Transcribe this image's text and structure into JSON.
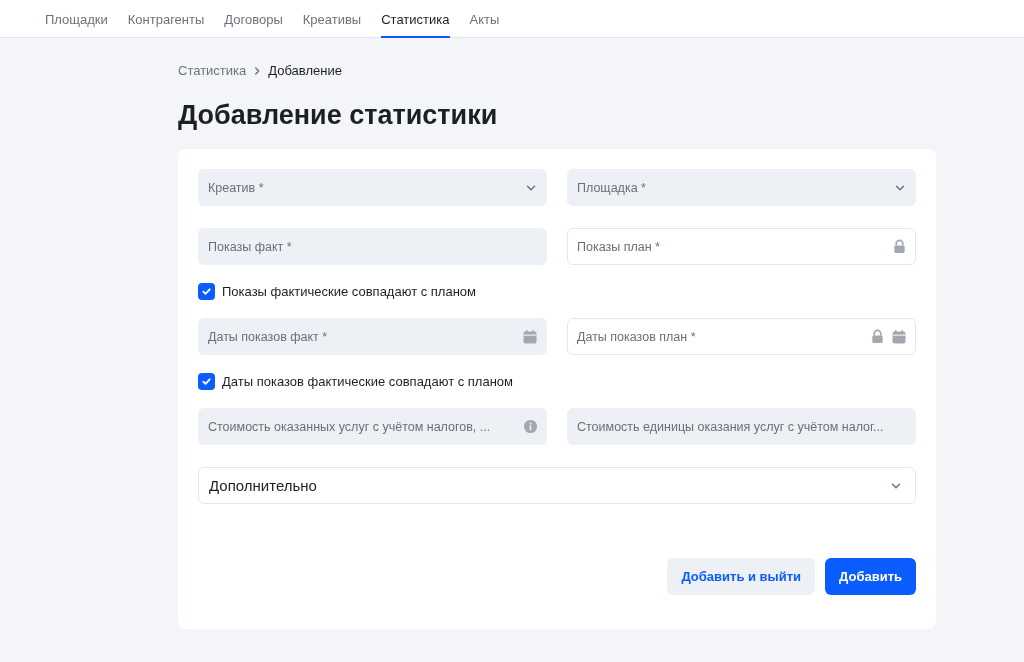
{
  "nav": {
    "tabs": [
      {
        "label": "Площадки",
        "selected": false
      },
      {
        "label": "Контрагенты",
        "selected": false
      },
      {
        "label": "Договоры",
        "selected": false
      },
      {
        "label": "Креативы",
        "selected": false
      },
      {
        "label": "Статистика",
        "selected": true
      },
      {
        "label": "Акты",
        "selected": false
      }
    ]
  },
  "breadcrumbs": [
    {
      "label": "Статистика"
    },
    {
      "label": "Добавление"
    }
  ],
  "title": "Добавление статистики",
  "form": {
    "rows": [
      {
        "kind": "fields",
        "fields": [
          {
            "kind": "select",
            "placeholder": "Креатив *",
            "locked": false,
            "info": false
          },
          {
            "kind": "select",
            "placeholder": "Площадка *",
            "locked": false,
            "info": false
          }
        ]
      },
      {
        "kind": "fields",
        "fields": [
          {
            "kind": "text",
            "placeholder": "Показы факт *",
            "locked": false,
            "info": false
          },
          {
            "kind": "text",
            "placeholder": "Показы план *",
            "locked": true,
            "info": false
          }
        ]
      },
      {
        "kind": "checkbox",
        "label": "Показы фактические совпадают с планом",
        "checked": true
      },
      {
        "kind": "fields",
        "fields": [
          {
            "kind": "date",
            "placeholder": "Даты показов факт *",
            "locked": false,
            "info": false
          },
          {
            "kind": "date",
            "placeholder": "Даты показов план *",
            "locked": true,
            "info": false
          }
        ]
      },
      {
        "kind": "checkbox",
        "label": "Даты показов фактические совпадают с планом",
        "checked": true
      },
      {
        "kind": "fields",
        "fields": [
          {
            "kind": "text",
            "placeholder": "Стоимость оказанных услуг с учётом налогов, ...",
            "locked": false,
            "info": true
          },
          {
            "kind": "text",
            "placeholder": "Стоимость единицы оказания услуг с учётом налог...",
            "locked": false,
            "info": false
          }
        ]
      }
    ],
    "accordion": {
      "label": "Дополнительно",
      "expanded": false
    },
    "buttons": [
      {
        "label": "Добавить и выйти",
        "kind": "secondary"
      },
      {
        "label": "Добавить",
        "kind": "primary"
      }
    ]
  }
}
